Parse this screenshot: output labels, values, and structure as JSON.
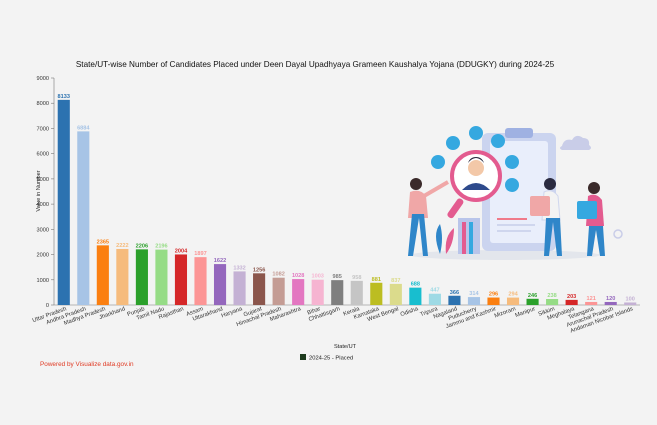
{
  "chart_data": {
    "type": "bar",
    "title": "State/UT-wise Number of Candidates Placed under Deen Dayal Upadhyaya Grameen Kaushalya Yojana (DDUGKY) during 2024-25",
    "xlabel": "State/UT",
    "ylabel": "Value in Number",
    "ylim": [
      0,
      9000
    ],
    "yticks": [
      "0",
      "1000",
      "2000",
      "3000",
      "4000",
      "5000",
      "6000",
      "7000",
      "8000",
      "9000"
    ],
    "grid": false,
    "legend_position": "bottom",
    "categories": [
      "Uttar Pradesh",
      "Andhra Pradesh",
      "Madhya Pradesh",
      "Jharkhand",
      "Punjab",
      "Tamil Nadu",
      "Rajasthan",
      "Assam",
      "Uttarakhand",
      "Haryana",
      "Gujarat",
      "Himachal Pradesh",
      "Maharashtra",
      "Bihar",
      "Chhattisgarh",
      "Kerala",
      "Karnataka",
      "West Bengal",
      "Odisha",
      "Tripura",
      "Nagaland",
      "Puducherry",
      "Jammu and Kashmir",
      "Mizoram",
      "Manipur",
      "Sikkim",
      "Meghalaya",
      "Telangana",
      "Arunachal Pradesh",
      "Andaman Nicobar Islands"
    ],
    "series": [
      {
        "name": "2024-25 - Placed",
        "values": [
          8133,
          6884,
          2365,
          2222,
          2206,
          2196,
          2004,
          1897,
          1622,
          1332,
          1256,
          1082,
          1028,
          1003,
          985,
          958,
          881,
          837,
          688,
          447,
          366,
          314,
          296,
          294,
          246,
          238,
          203,
          121,
          120,
          100
        ]
      }
    ],
    "colors": [
      "#2c72b0",
      "#a7c4e6",
      "#fb7f10",
      "#f6bb7c",
      "#2ba02b",
      "#96dc86",
      "#d52728",
      "#fc9595",
      "#9467bd",
      "#c4b1d4",
      "#8b564c",
      "#c49c94",
      "#e377c1",
      "#f6b4d1",
      "#7f7f7f",
      "#c5c5c5",
      "#bcbd21",
      "#dbdb8c",
      "#18becf",
      "#9edae5",
      "#2c72b0",
      "#a7c4e6",
      "#fb7f10",
      "#f6bb7c",
      "#2ba02b",
      "#96dc86",
      "#d52728",
      "#fc9595",
      "#9467bd",
      "#c4b1d4"
    ],
    "legend_swatch_color": "#1c3a1c"
  },
  "footer": {
    "powered_by": "Powered by Visualize data.gov.in"
  }
}
